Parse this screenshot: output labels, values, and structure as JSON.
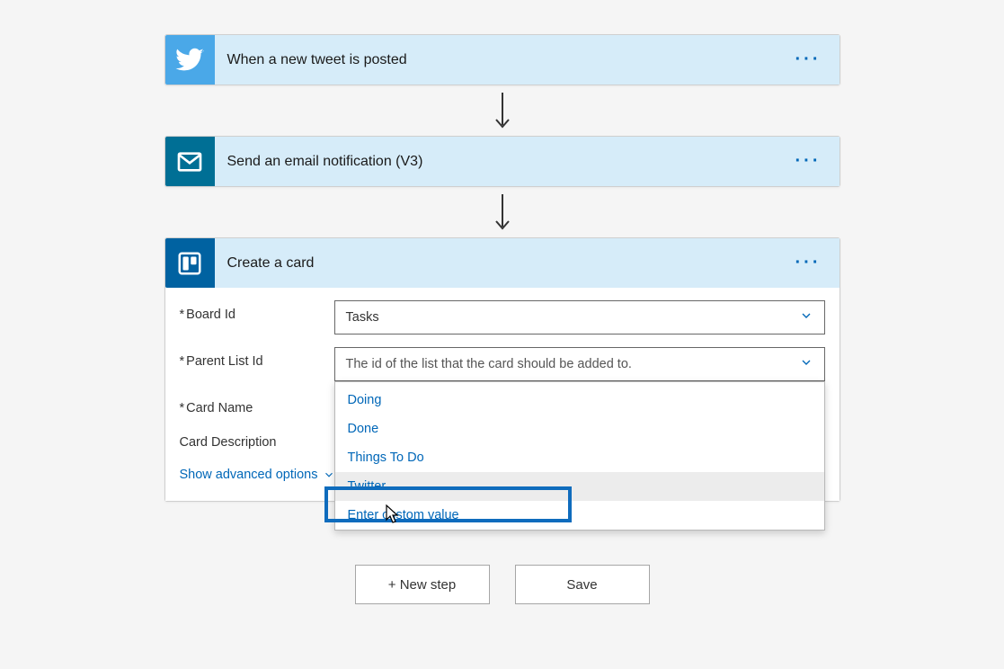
{
  "steps": {
    "twitter": {
      "title": "When a new tweet is posted"
    },
    "email": {
      "title": "Send an email notification (V3)"
    },
    "trello": {
      "title": "Create a card"
    }
  },
  "fields": {
    "board_id": {
      "label": "Board Id",
      "value": "Tasks"
    },
    "parent_list_id": {
      "label": "Parent List Id",
      "placeholder": "The id of the list that the card should be added to."
    },
    "card_name": {
      "label": "Card Name"
    },
    "card_description": {
      "label": "Card Description"
    }
  },
  "dropdown_options": [
    "Doing",
    "Done",
    "Things To Do",
    "Twitter",
    "Enter custom value"
  ],
  "advanced_link": "Show advanced options",
  "buttons": {
    "new_step": "+ New step",
    "save": "Save"
  }
}
